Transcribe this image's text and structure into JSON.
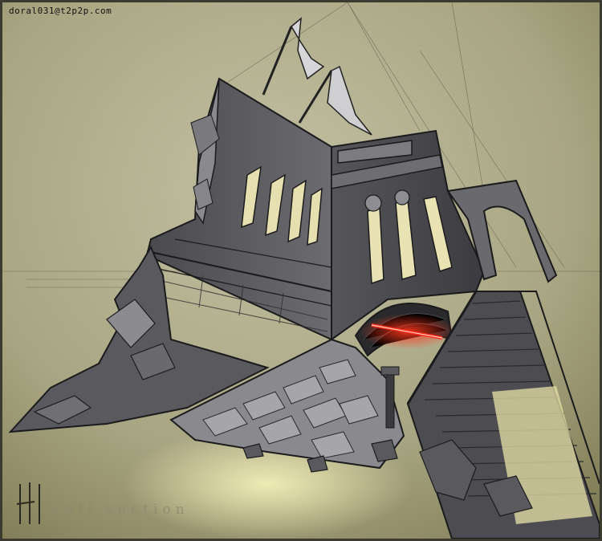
{
  "watermark": "doral031@t2p2p.com",
  "caption": "wall section",
  "signature_mark": "H",
  "colors": {
    "background_light": "#b6b596",
    "background_dark": "#7f7c55",
    "stone_dark": "#3a3a3c",
    "stone_mid": "#5e5e62",
    "stone_light": "#8d8d90",
    "light_glow": "#ece6a8",
    "red_glow": "#ff2a18"
  }
}
